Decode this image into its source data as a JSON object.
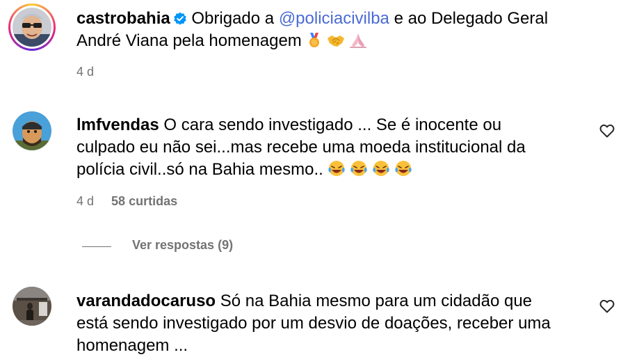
{
  "post": {
    "username": "castrobahia",
    "text_before": "Obrigado a",
    "mention": "@policiacivilba",
    "text_after": "e ao Delegado Geral André Viana pela homenagem",
    "emojis": [
      "medal",
      "handshake",
      "folded-hands"
    ],
    "time": "4 d"
  },
  "comments": [
    {
      "username": "lmfvendas",
      "text": "O cara sendo investigado ... Se é inocente ou culpado eu não sei...mas recebe uma moeda institucional da polícia civil..só na Bahia mesmo..",
      "emojis": [
        "laughing-tears",
        "laughing-tears",
        "laughing-tears",
        "laughing-tears"
      ],
      "time": "4 d",
      "likes": "58 curtidas",
      "replies_label": "Ver respostas (9)"
    },
    {
      "username": "varandadocaruso",
      "text": "Só na Bahia mesmo para um cidadão que está sendo investigado por um desvio de doações, receber uma homenagem ..."
    }
  ],
  "colors": {
    "mention": "#4a6bd6",
    "meta": "#737373",
    "verified": "#0095f6"
  }
}
